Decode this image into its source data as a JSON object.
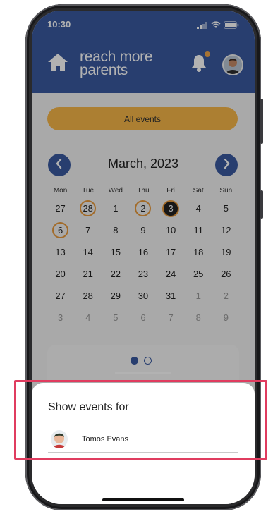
{
  "status": {
    "time": "10:30"
  },
  "brand": {
    "line1": "reach more",
    "line2": "parents"
  },
  "filter": {
    "label": "All events"
  },
  "calendar": {
    "title": "March, 2023",
    "weekdays": [
      "Mon",
      "Tue",
      "Wed",
      "Thu",
      "Fri",
      "Sat",
      "Sun"
    ],
    "weeks": [
      [
        {
          "d": "27",
          "m": false
        },
        {
          "d": "28",
          "m": false,
          "ring": true
        },
        {
          "d": "1",
          "m": false
        },
        {
          "d": "2",
          "m": false,
          "ring": true
        },
        {
          "d": "3",
          "m": false,
          "today": true
        },
        {
          "d": "4",
          "m": false
        },
        {
          "d": "5",
          "m": false
        }
      ],
      [
        {
          "d": "6",
          "m": false,
          "ring": true
        },
        {
          "d": "7",
          "m": false
        },
        {
          "d": "8",
          "m": false
        },
        {
          "d": "9",
          "m": false
        },
        {
          "d": "10",
          "m": false
        },
        {
          "d": "11",
          "m": false
        },
        {
          "d": "12",
          "m": false
        }
      ],
      [
        {
          "d": "13",
          "m": false
        },
        {
          "d": "14",
          "m": false
        },
        {
          "d": "15",
          "m": false
        },
        {
          "d": "16",
          "m": false
        },
        {
          "d": "17",
          "m": false
        },
        {
          "d": "18",
          "m": false
        },
        {
          "d": "19",
          "m": false
        }
      ],
      [
        {
          "d": "20",
          "m": false
        },
        {
          "d": "21",
          "m": false
        },
        {
          "d": "22",
          "m": false
        },
        {
          "d": "23",
          "m": false
        },
        {
          "d": "24",
          "m": false
        },
        {
          "d": "25",
          "m": false
        },
        {
          "d": "26",
          "m": false
        }
      ],
      [
        {
          "d": "27",
          "m": false
        },
        {
          "d": "28",
          "m": false
        },
        {
          "d": "29",
          "m": false
        },
        {
          "d": "30",
          "m": false
        },
        {
          "d": "31",
          "m": false
        },
        {
          "d": "1",
          "m": true
        },
        {
          "d": "2",
          "m": true
        }
      ],
      [
        {
          "d": "3",
          "m": true
        },
        {
          "d": "4",
          "m": true
        },
        {
          "d": "5",
          "m": true
        },
        {
          "d": "6",
          "m": true
        },
        {
          "d": "7",
          "m": true
        },
        {
          "d": "8",
          "m": true
        },
        {
          "d": "9",
          "m": true
        }
      ]
    ]
  },
  "pager": {
    "count": 2,
    "active": 0
  },
  "sheet": {
    "title": "Show events for",
    "person_name": "Tomos Evans"
  },
  "colors": {
    "header": "#3a5aa0",
    "accent": "#f7b648",
    "ring": "#e89a3c",
    "highlight": "#e03c5f"
  }
}
